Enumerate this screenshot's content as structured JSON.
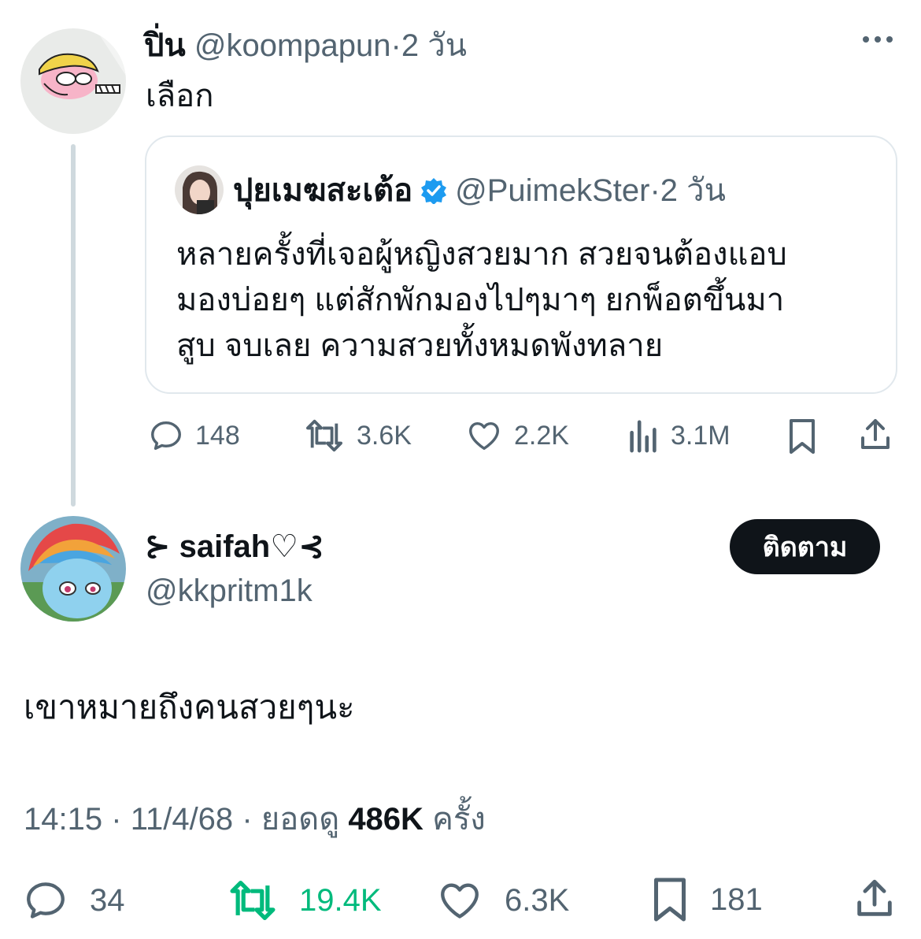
{
  "parent_tweet": {
    "display_name": "ปิ่น",
    "handle": "@koompapun",
    "separator": "·",
    "time_ago": "2 วัน",
    "text": "เลือก",
    "quote": {
      "display_name": "ปุยเมฆสะเต้อ",
      "handle": "@PuimekSter",
      "separator": "·",
      "time_ago": "2 วัน",
      "lines": [
        "หลายครั้งที่เจอผู้หญิงสวยมาก สวยจนต้องแอบ",
        "มองบ่อยๆ แต่สักพักมองไปๆมาๆ ยกพ็อตขึ้นมา",
        "สูบ จบเลย ความสวยทั้งหมดพังทลาย"
      ]
    },
    "stats": {
      "replies": "148",
      "reposts": "3.6K",
      "likes": "2.2K",
      "views": "3.1M"
    }
  },
  "main_tweet": {
    "display_name": "⊱ saifah♡⊰",
    "handle": "@kkpritm1k",
    "follow_label": "ติดตาม",
    "text": "เขาหมายถึงคนสวยๆนะ",
    "time": "14:15",
    "date": "11/4/68",
    "views_label": "ยอดดู",
    "views_count": "486K",
    "views_suffix": "ครั้ง",
    "dot": "·",
    "stats": {
      "replies": "34",
      "reposts": "19.4K",
      "likes": "6.3K",
      "bookmarks": "181"
    }
  },
  "colors": {
    "text": "#0f1419",
    "muted": "#536471",
    "repost_active": "#00ba7c",
    "verified": "#1d9bf0",
    "thread_line": "#cfd9de"
  }
}
